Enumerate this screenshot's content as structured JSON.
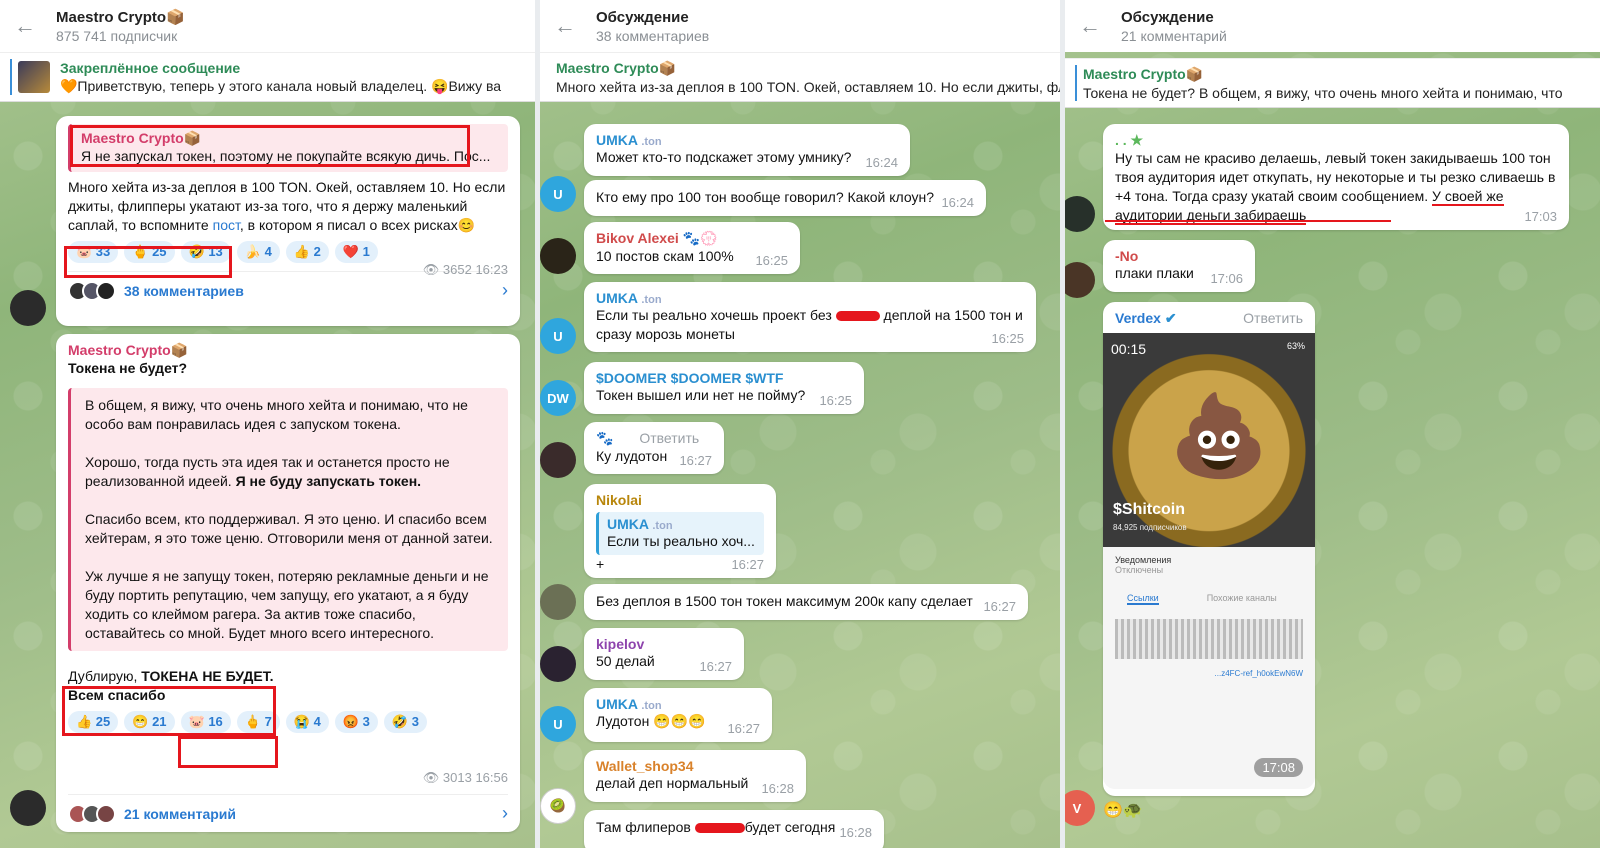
{
  "panel1": {
    "channel_title": "Maestro Crypto📦",
    "subscribers": "875 741 подписчик",
    "pinned_label": "Закреплённое сообщение",
    "pinned_text": "🧡Приветствую, теперь у этого канала новый владелец.   😝Вижу ва",
    "post1": {
      "quote_author": "Maestro Crypto📦",
      "quote_text": "Я не запускал токен, поэтому не покупайте всякую дичь. Пос...",
      "text_a": "Много хейта из-за деплоя в 100 TON. Окей, оставляем 10. Но если джиты, флипперы укатают из-за того, что я держу маленький саплай, то вспомните ",
      "link": "пост",
      "text_b": ", в котором я писал о всех рисках😊",
      "reactions": [
        "🐷 33",
        "🖕 25",
        "🤣 13",
        "🍌 4",
        "👍 2",
        "❤️ 1"
      ],
      "views": "👁 3652",
      "time": "16:23",
      "comments": "38 комментариев"
    },
    "post2": {
      "author": "Maestro Crypto📦",
      "title": "Токена не будет?",
      "q1": "В общем, я вижу, что очень много хейта и понимаю, что не особо вам понравилась идея с запуском токена.",
      "q2a": "Хорошо, тогда пусть эта идея так и останется просто не реализованной идеей. ",
      "q2b": "Я не буду запускать токен.",
      "q3": "Спасибо всем, кто поддерживал. Я это ценю. И спасибо всем хейтерам, я это тоже ценю. Отговорили меня от данной затеи.",
      "q4": "Уж лучше я не запущу токен, потеряю рекламные деньги и не буду портить репутацию, чем запущу, его укатают, а я буду ходить со клеймом рагера. За актив тоже спасибо, оставайтесь со мной. Будет много всего интересного.",
      "dup_a": "Дублирую, ",
      "dup_b": "ТОКЕНА НЕ БУДЕТ.",
      "dup_c": "Всем спасибо",
      "reactions": [
        "👍 25",
        "😁 21",
        "🐷 16",
        "🖕 7",
        "😭 4",
        "😡 3",
        "🤣 3"
      ],
      "views": "👁 3013",
      "time": "16:56",
      "comments": "21 комментарий"
    }
  },
  "panel2": {
    "title": "Обсуждение",
    "subtitle": "38 комментариев",
    "pin_author": "Maestro Crypto📦",
    "pin_text": "Много хейта из-за деплоя в 100 TON. Окей, оставляем 10. Но если джиты, фл",
    "messages": [
      {
        "name": "UMKA",
        "tag": ".ton",
        "text": "Может кто-то подскажет этому умнику?",
        "time": "16:24"
      },
      {
        "name": "",
        "text": "Кто ему про 100 тон вообще говорил? Какой клоун?",
        "time": "16:24",
        "avatar": "U"
      },
      {
        "name": "Bikov Alexei 🐾💮",
        "text": "10 постов скам 100%",
        "time": "16:25"
      },
      {
        "name": "UMKA",
        "tag": ".ton",
        "text_a": "Если ты реально хочешь проект без ",
        "text_b": " деплой на 1500 тон и сразу морозь монеты",
        "time": "16:25",
        "avatar": "U"
      },
      {
        "name": "$DOOMER $DOOMER $WTF",
        "text": "Токен вышел или нет не пойму?",
        "time": "16:25",
        "avatar": "DW"
      },
      {
        "name": "🐾",
        "reply_label": "Ответить",
        "text": "Ку лудотон",
        "time": "16:27"
      },
      {
        "name": "Nikolai",
        "reply_name": "UMKA",
        "reply_tag": ".ton",
        "reply_text": "Если ты реально хоч...",
        "text": "+",
        "time": "16:27"
      },
      {
        "name": "",
        "text": "Без деплоя в 1500 тон токен максимум 200к капу сделает",
        "time": "16:27"
      },
      {
        "name": "kipelov",
        "text": "50 делай",
        "time": "16:27"
      },
      {
        "name": "UMKA",
        "tag": ".ton",
        "text": "Лудотон 😁😁😁",
        "time": "16:27",
        "avatar": "U"
      },
      {
        "name": "Wallet_shop34",
        "text": "делай деп нормальный",
        "time": "16:28"
      },
      {
        "name": "",
        "text_a": "Там флиперов ",
        "text_b": "будет сегодня",
        "time": "16:28"
      }
    ]
  },
  "panel3": {
    "title": "Обсуждение",
    "subtitle": "21 комментарий",
    "pin_author": "Maestro Crypto📦",
    "pin_text": "Токена не будет?   В общем, я вижу, что очень много хейта и понимаю, что",
    "msg1": {
      "name": ". . ★",
      "text_a": "Ну ты сам не красиво делаешь, левый токен закидываешь 100 тон твоя аудитория идет откупать, ну некоторые и ты резко сливаешь в +4 тона. Тогда сразу укатай своим сообщением. ",
      "text_b": "У своей же аудитории деньги забираешь",
      "time": "17:03"
    },
    "msg2": {
      "name": "-No",
      "text": "плаки плаки",
      "time": "17:06"
    },
    "msg3": {
      "name": "Verdex",
      "reply_label": "Ответить",
      "video_time": "00:15",
      "battery": "63%",
      "coin_label": "$Shitcoin",
      "coin_sub": "84,925 подписчиков",
      "notif_label": "Уведомления",
      "notif_sub": "Отключены",
      "tab_links": "Ссылки",
      "tab_similar": "Похожие каналы",
      "link_text": "...z4FC-ref_h0okEwN6W",
      "time": "17:08"
    },
    "avatar_v": "V",
    "reactions_mini": "😁🐢"
  },
  "colors": {
    "accent": "#2a7ad0",
    "name_green": "#2e8b57",
    "red": "#e5161d"
  }
}
